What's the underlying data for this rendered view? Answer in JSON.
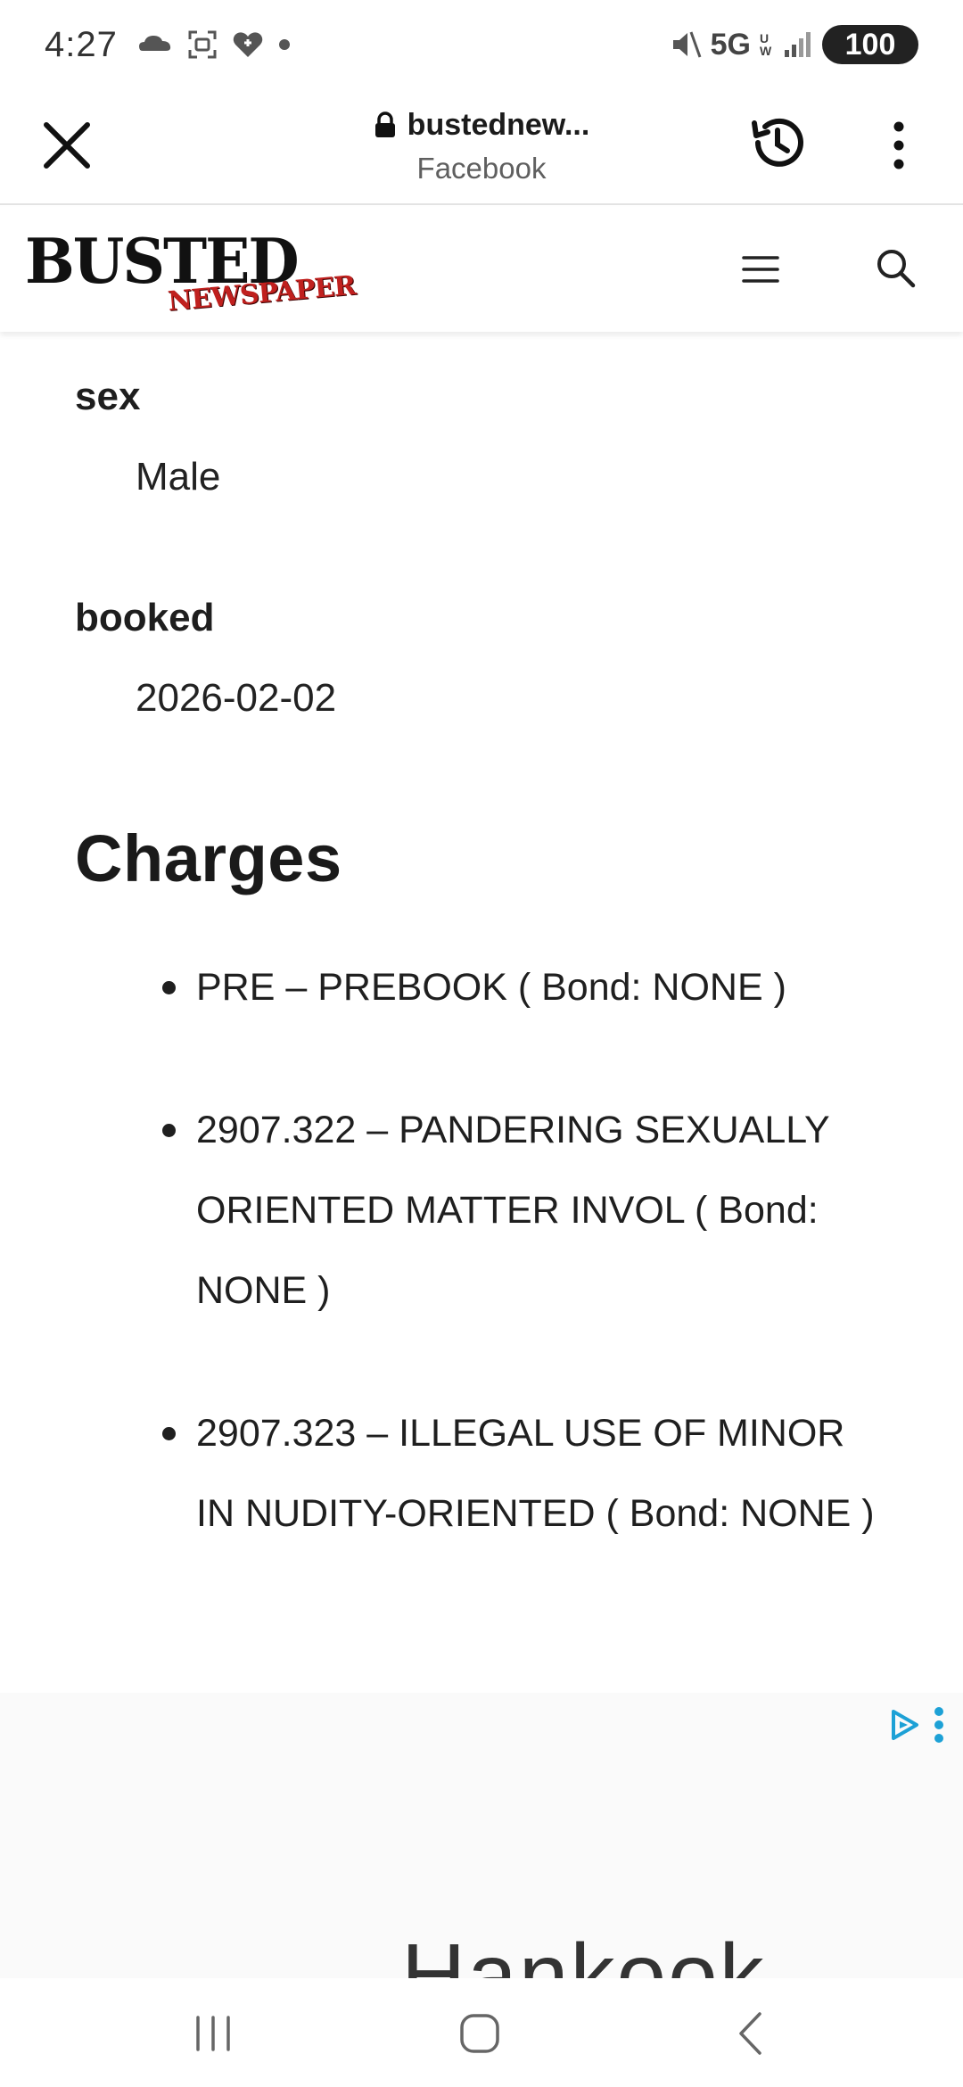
{
  "status_bar": {
    "time": "4:27",
    "network": "5G",
    "network_sub": "UW",
    "battery": "100"
  },
  "browser": {
    "url": "bustednew...",
    "source": "Facebook"
  },
  "site": {
    "logo_main": "BUSTED",
    "logo_sub": "NEWSPAPER",
    "logo_sub_color": "#c0201e"
  },
  "record": {
    "sex_label": "sex",
    "sex_value": "Male",
    "booked_label": "booked",
    "booked_value": "2026-02-02"
  },
  "charges": {
    "title": "Charges",
    "items": [
      "PRE – PREBOOK ( Bond: NONE )",
      "2907.322 – PANDERING SEXUALLY ORIENTED MATTER INVOL ( Bond: NONE )",
      "2907.323 – ILLEGAL USE OF MINOR IN NUDITY-ORIENTED ( Bond: NONE )"
    ]
  },
  "ad": {
    "brand_text": "Hankook",
    "accent_color": "#1da1d6"
  }
}
